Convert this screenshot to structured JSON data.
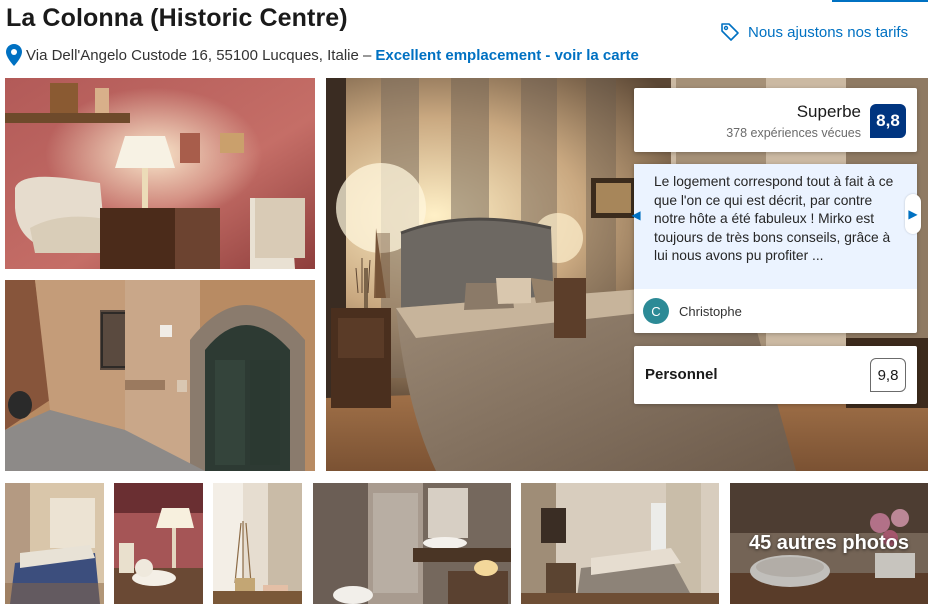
{
  "property": {
    "title": "La Colonna (Historic Centre)",
    "address": "Via Dell'Angelo Custode 16, 55100 Lucques, Italie –",
    "map_link": "Excellent emplacement - voir la carte",
    "price_match": "Nous ajustons nos tarifs"
  },
  "review_score": {
    "label": "Superbe",
    "count": "378 expériences vécues",
    "score": "8,8"
  },
  "featured_review": {
    "text": "Le logement correspond tout à fait à ce que l'on ce qui est décrit, par contre notre hôte a été fabuleux ! Mirko est toujours de très bons conseils, grâce à lui nous avons pu profiter ...",
    "author": "Christophe",
    "author_initial": "C"
  },
  "category_score": {
    "label": "Personnel",
    "score": "9,8"
  },
  "gallery": {
    "more_photos": "45 autres photos"
  },
  "colors": {
    "brand_blue": "#0071c2",
    "score_badge": "#003580",
    "review_bg": "#ebf3ff",
    "avatar": "#2c8a96"
  },
  "icons": [
    "map-pin-icon",
    "price-tag-icon",
    "chevron-left-icon",
    "chevron-right-icon"
  ]
}
